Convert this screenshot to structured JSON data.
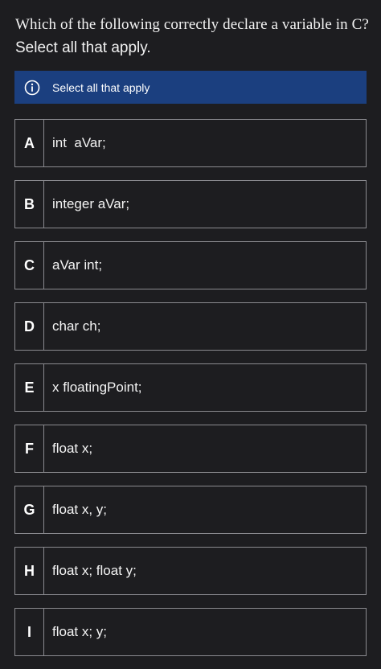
{
  "question": {
    "title": "Which of the following correctly declare a variable in C?",
    "subtitle": "Select all that apply."
  },
  "banner": {
    "icon": "info-icon",
    "text": "Select all that apply",
    "background": "#1b3f7f"
  },
  "options": [
    {
      "letter": "A",
      "text": "int  aVar;"
    },
    {
      "letter": "B",
      "text": "integer aVar;"
    },
    {
      "letter": "C",
      "text": "aVar int;"
    },
    {
      "letter": "D",
      "text": "char ch;"
    },
    {
      "letter": "E",
      "text": "x floatingPoint;"
    },
    {
      "letter": "F",
      "text": "float x;"
    },
    {
      "letter": "G",
      "text": "float x, y;"
    },
    {
      "letter": "H",
      "text": "float x; float y;"
    },
    {
      "letter": "I",
      "text": "float x; y;"
    }
  ]
}
